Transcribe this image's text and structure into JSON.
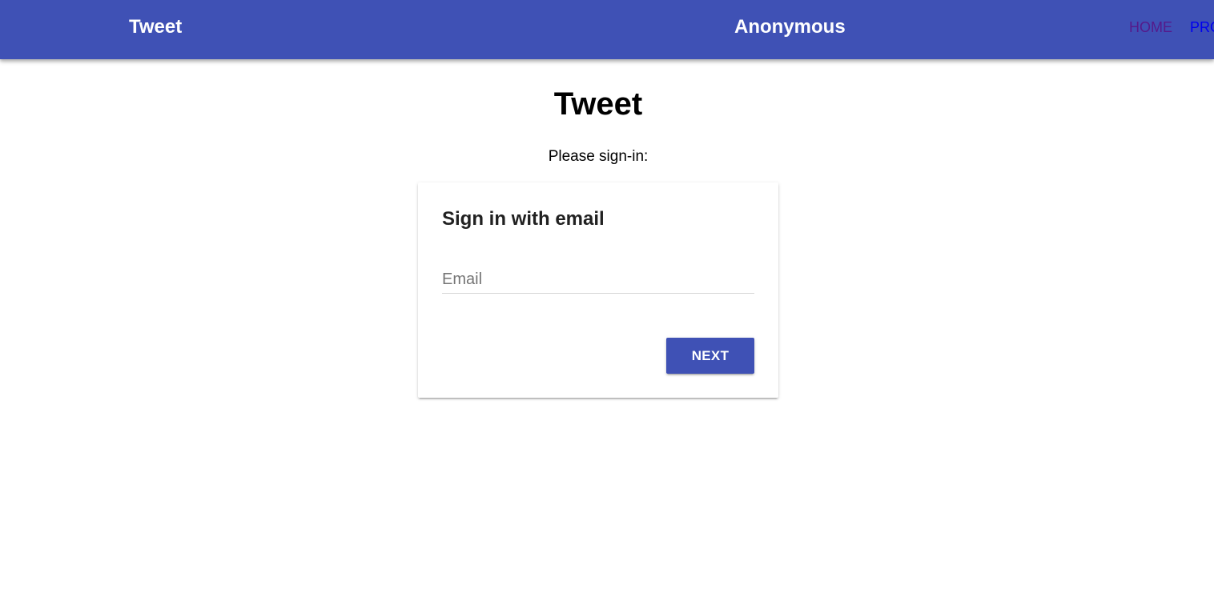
{
  "appbar": {
    "brand": "Tweet",
    "user_name": "Anonymous",
    "nav": {
      "home": "HOME",
      "profile": "PRO"
    },
    "color": "#3f51b5"
  },
  "main": {
    "title": "Tweet",
    "subtitle": "Please sign-in:"
  },
  "signin_card": {
    "title": "Sign in with email",
    "email_value": "",
    "email_placeholder": "Email",
    "next_label": "NEXT"
  },
  "colors": {
    "primary": "#3f51b5",
    "visited_link": "#551a8b",
    "link": "#0000ee"
  }
}
